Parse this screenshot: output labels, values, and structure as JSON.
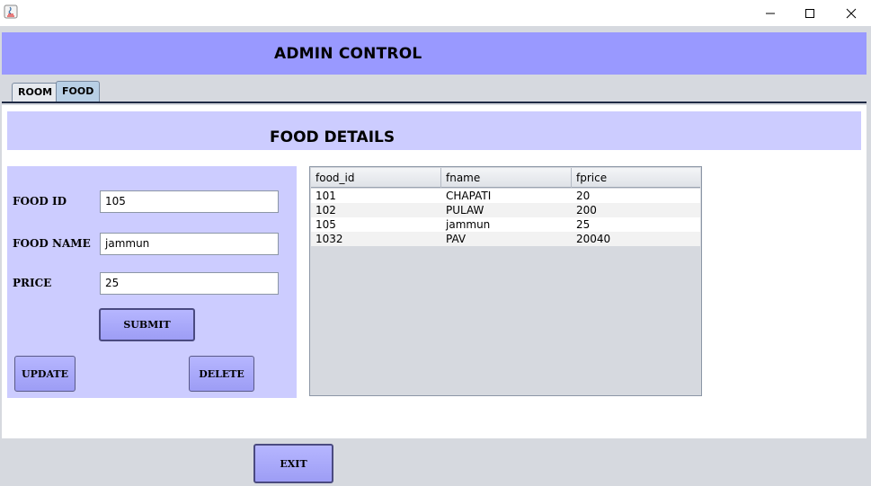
{
  "window": {
    "minimize_glyph": "—",
    "maximize_glyph": "☐",
    "close_glyph": "✕"
  },
  "header": {
    "title": "ADMIN CONTROL"
  },
  "tabs": [
    {
      "label": "ROOM",
      "selected": false
    },
    {
      "label": "FOOD",
      "selected": true
    }
  ],
  "food_panel": {
    "title": "FOOD DETAILS",
    "form": {
      "food_id_label": "FOOD ID",
      "food_id_value": "105",
      "food_name_label": "FOOD NAME",
      "food_name_value": "jammun",
      "price_label": "PRICE",
      "price_value": "25",
      "submit_label": "SUBMIT",
      "update_label": "UPDATE",
      "delete_label": "DELETE"
    },
    "table": {
      "columns": [
        "food_id",
        "fname",
        "fprice"
      ],
      "rows": [
        [
          "101",
          "CHAPATI",
          "20"
        ],
        [
          "102",
          "PULAW",
          "200"
        ],
        [
          "105",
          "jammun",
          "25"
        ],
        [
          "1032",
          "PAV",
          "20040"
        ]
      ]
    }
  },
  "footer": {
    "exit_label": "EXIT"
  },
  "colors": {
    "header_band": "#9999ff",
    "panel": "#ccccff",
    "frame_bg": "#d6d9df"
  }
}
